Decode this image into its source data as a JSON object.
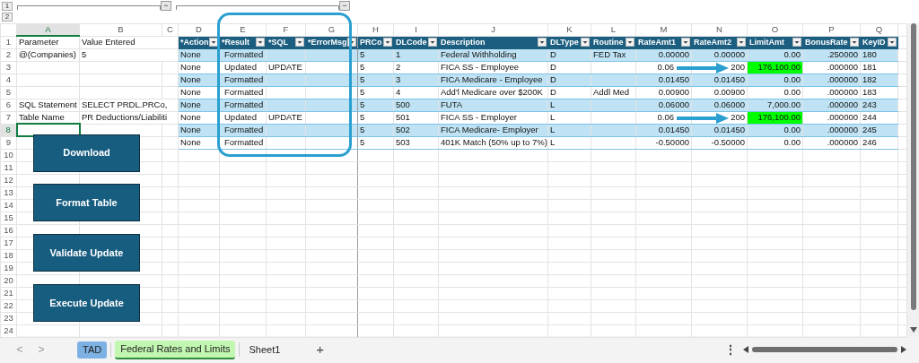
{
  "outline": {
    "levels": [
      "1",
      "2"
    ],
    "collapse_buttons": [
      "−",
      "−"
    ]
  },
  "column_letters": [
    {
      "label": "A",
      "selected": true
    },
    {
      "label": "B",
      "selected": false
    },
    {
      "label": "C",
      "selected": false
    },
    {
      "label": "D",
      "selected": false
    },
    {
      "label": "E",
      "selected": false
    },
    {
      "label": "F",
      "selected": false
    },
    {
      "label": "G",
      "selected": false
    },
    {
      "label": "H",
      "selected": false
    },
    {
      "label": "I",
      "selected": false
    },
    {
      "label": "J",
      "selected": false
    },
    {
      "label": "K",
      "selected": false
    },
    {
      "label": "L",
      "selected": false
    },
    {
      "label": "M",
      "selected": false
    },
    {
      "label": "N",
      "selected": false
    },
    {
      "label": "O",
      "selected": false
    },
    {
      "label": "P",
      "selected": false
    },
    {
      "label": "Q",
      "selected": false
    }
  ],
  "sheet_rows": [
    {
      "number": "1",
      "selected": false,
      "a": "Parameter",
      "b": "Value Entered"
    },
    {
      "number": "2",
      "selected": false,
      "a": "@(Companies)",
      "b": "5"
    },
    {
      "number": "3",
      "selected": false
    },
    {
      "number": "4",
      "selected": false
    },
    {
      "number": "5",
      "selected": false
    },
    {
      "number": "6",
      "selected": false,
      "a": "SQL Statement",
      "b": "SELECT PRDL.PRCo,"
    },
    {
      "number": "7",
      "selected": false,
      "a": "Table Name",
      "b": "PR Deductions/Liabiliti"
    },
    {
      "number": "8",
      "selected": true
    },
    {
      "number": "9",
      "selected": false
    },
    {
      "number": "10",
      "selected": false
    },
    {
      "number": "11",
      "selected": false
    },
    {
      "number": "12",
      "selected": false
    },
    {
      "number": "13",
      "selected": false
    },
    {
      "number": "14",
      "selected": false
    },
    {
      "number": "15",
      "selected": false
    },
    {
      "number": "16",
      "selected": false
    },
    {
      "number": "17",
      "selected": false
    },
    {
      "number": "18",
      "selected": false
    },
    {
      "number": "19",
      "selected": false
    },
    {
      "number": "20",
      "selected": false
    },
    {
      "number": "21",
      "selected": false
    },
    {
      "number": "22",
      "selected": false
    },
    {
      "number": "23",
      "selected": false
    },
    {
      "number": "24",
      "selected": false
    }
  ],
  "table": {
    "columns": [
      "*Action",
      "*Result",
      "*SQL",
      "*ErrorMsg",
      "PRCo",
      "DLCode",
      "Description",
      "DLType",
      "Routine",
      "RateAmt1",
      "RateAmt2",
      "LimitAmt",
      "BonusRate",
      "KeyID"
    ],
    "rows": [
      {
        "action": "None",
        "result": "Formatted",
        "prco": "5",
        "dlcode": "1",
        "description": "Federal Withholding",
        "dltype": "D",
        "routine": "FED Tax",
        "rate_amt1": "0.00000",
        "rate_amt2": "0.00000",
        "limit_amt": "0.00",
        "bonus_rate": ".250000",
        "key_id": "180",
        "limit_highlight": false,
        "arrow": false
      },
      {
        "action": "None",
        "result": "Updated",
        "sql": "UPDATE",
        "prco": "5",
        "dlcode": "2",
        "description": "FICA SS - Employee",
        "dltype": "D",
        "rate_amt1": "0.06",
        "rate_amt2": "200",
        "limit_amt": "176,100.00",
        "bonus_rate": ".000000",
        "key_id": "181",
        "limit_highlight": true,
        "arrow": true
      },
      {
        "action": "None",
        "result": "Formatted",
        "prco": "5",
        "dlcode": "3",
        "description": "FICA Medicare - Employee",
        "dltype": "D",
        "rate_amt1": "0.01450",
        "rate_amt2": "0.01450",
        "limit_amt": "0.00",
        "bonus_rate": ".000000",
        "key_id": "182",
        "limit_highlight": false,
        "arrow": false
      },
      {
        "action": "None",
        "result": "Formatted",
        "prco": "5",
        "dlcode": "4",
        "description": "Add'l Medicare over $200K",
        "dltype": "D",
        "routine": "Addl Med",
        "rate_amt1": "0.00900",
        "rate_amt2": "0.00900",
        "limit_amt": "0.00",
        "bonus_rate": ".000000",
        "key_id": "183",
        "limit_highlight": false,
        "arrow": false
      },
      {
        "action": "None",
        "result": "Formatted",
        "prco": "5",
        "dlcode": "500",
        "description": "FUTA",
        "dltype": "L",
        "rate_amt1": "0.06000",
        "rate_amt2": "0.06000",
        "limit_amt": "7,000.00",
        "bonus_rate": ".000000",
        "key_id": "243",
        "limit_highlight": false,
        "arrow": false
      },
      {
        "action": "None",
        "result": "Updated",
        "sql": "UPDATE",
        "prco": "5",
        "dlcode": "501",
        "description": "FICA SS - Employer",
        "dltype": "L",
        "rate_amt1": "0.06",
        "rate_amt2": "200",
        "limit_amt": "176,100.00",
        "bonus_rate": ".000000",
        "key_id": "244",
        "limit_highlight": true,
        "arrow": true
      },
      {
        "action": "None",
        "result": "Formatted",
        "prco": "5",
        "dlcode": "502",
        "description": "FICA Medicare- Employer",
        "dltype": "L",
        "rate_amt1": "0.01450",
        "rate_amt2": "0.01450",
        "limit_amt": "0.00",
        "bonus_rate": ".000000",
        "key_id": "245",
        "limit_highlight": false,
        "arrow": false
      },
      {
        "action": "None",
        "result": "Formatted",
        "prco": "5",
        "dlcode": "503",
        "description": "401K Match (50% up to 7%)",
        "dltype": "L",
        "rate_amt1": "-0.50000",
        "rate_amt2": "-0.50000",
        "limit_amt": "0.00",
        "bonus_rate": ".000000",
        "key_id": "246",
        "limit_highlight": false,
        "arrow": false
      }
    ]
  },
  "buttons": [
    "Download",
    "Format Table",
    "Validate Update",
    "Execute Update"
  ],
  "tab_nav": [
    "<",
    ">"
  ],
  "sheet_tabs": [
    {
      "label": "TAD",
      "selected": false,
      "color": "#7eb1e3"
    },
    {
      "label": "Federal Rates and Limits",
      "selected": true,
      "color": "#c2f7b2"
    },
    {
      "label": "Sheet1",
      "selected": false
    }
  ],
  "add_sheet": "+",
  "more_menu": "⋮"
}
